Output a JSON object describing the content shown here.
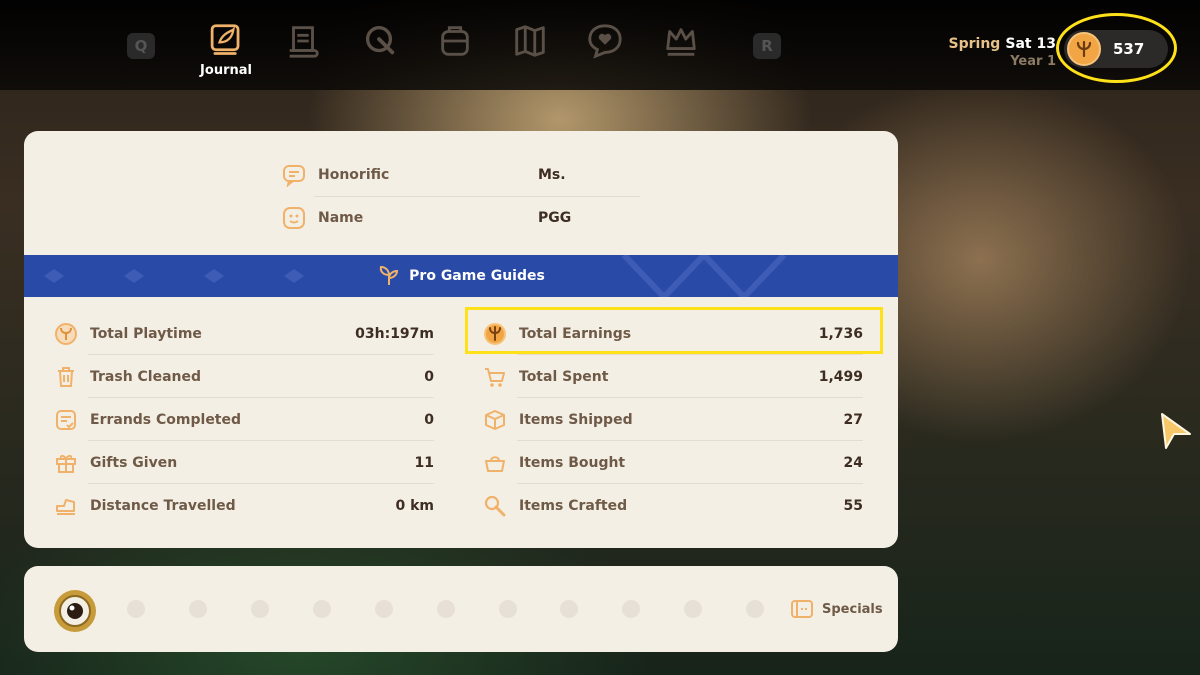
{
  "topbar": {
    "left_key": "Q",
    "right_key": "R",
    "tabs": [
      {
        "label": "Journal",
        "icon": "journal-icon"
      },
      {
        "label": "",
        "icon": "scroll-icon"
      },
      {
        "label": "",
        "icon": "wrench-icon"
      },
      {
        "label": "",
        "icon": "backpack-icon"
      },
      {
        "label": "",
        "icon": "map-icon"
      },
      {
        "label": "",
        "icon": "heart-chat-icon"
      },
      {
        "label": "",
        "icon": "crown-icon"
      }
    ],
    "season": "Spring",
    "day": "Sat 13",
    "year": "Year 1",
    "coins": "537"
  },
  "profile": {
    "honorific_label": "Honorific",
    "honorific_value": "Ms.",
    "name_label": "Name",
    "name_value": "PGG",
    "farm_name": "Pro Game Guides"
  },
  "stats_left": [
    {
      "label": "Total Playtime",
      "value": "03h:197m",
      "icon": "playtime-icon"
    },
    {
      "label": "Trash Cleaned",
      "value": "0",
      "icon": "trash-icon"
    },
    {
      "label": "Errands Completed",
      "value": "0",
      "icon": "errand-icon"
    },
    {
      "label": "Gifts Given",
      "value": "11",
      "icon": "gift-icon"
    },
    {
      "label": "Distance Travelled",
      "value": "0 km",
      "icon": "shoe-icon"
    }
  ],
  "stats_right": [
    {
      "label": "Total Earnings",
      "value": "1,736",
      "icon": "coin-icon"
    },
    {
      "label": "Total Spent",
      "value": "1,499",
      "icon": "cart-icon"
    },
    {
      "label": "Items Shipped",
      "value": "27",
      "icon": "box-icon"
    },
    {
      "label": "Items Bought",
      "value": "24",
      "icon": "basket-icon"
    },
    {
      "label": "Items Crafted",
      "value": "55",
      "icon": "craft-icon"
    }
  ],
  "bottom": {
    "specials_label": "Specials"
  },
  "colors": {
    "accent": "#f2a544",
    "banner": "#2a4aa8",
    "highlight": "#ffe11a",
    "card": "#f4efe5"
  }
}
